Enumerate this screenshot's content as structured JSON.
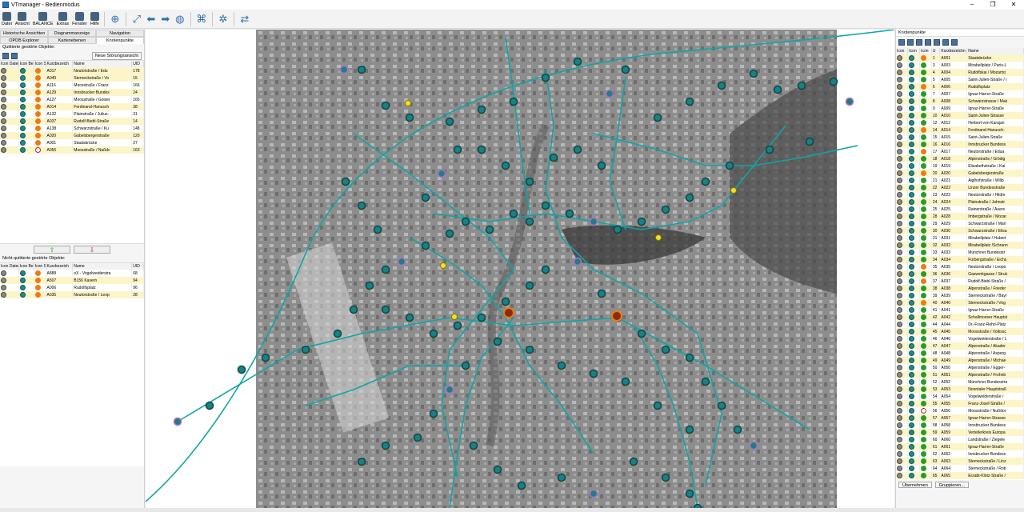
{
  "window": {
    "title": "VTmanager - Bedienmodus"
  },
  "toolbar": {
    "buttons": [
      {
        "label": "Datei",
        "icon": "file-icon"
      },
      {
        "label": "Ansicht",
        "icon": "view-icon"
      },
      {
        "label": "BALANCE",
        "icon": "balance-icon"
      },
      {
        "label": "Extras",
        "icon": "extras-icon"
      },
      {
        "label": "Fenster",
        "icon": "window-icon"
      },
      {
        "label": "Hilfe",
        "icon": "help-icon"
      }
    ]
  },
  "left_panel": {
    "tabs_row1": [
      "Historische Ansichten",
      "Diagrammanzeige",
      "Navigation"
    ],
    "tabs_row2": [
      "OPDB Explorer",
      "Kartenebenen",
      "Knotenpunkte"
    ],
    "top_section_label": "Quittierte gestörte Objekte:",
    "new_fault_button": "Neue Störungsansicht",
    "columns": [
      "Icon Dateria",
      "Icon Be",
      "Icon S",
      "Kurzbezeich",
      "Name",
      "UID"
    ],
    "acknowledged_rows": [
      {
        "status": "orange",
        "code": "A017",
        "name": "Neutorstraße / Edu",
        "uid": "178",
        "hl": true
      },
      {
        "status": "orange",
        "code": "A040",
        "name": "Sterneckstraße / Vo",
        "uid": "15",
        "hl": true
      },
      {
        "status": "orange",
        "code": "A116",
        "name": "Moosstraße / Franz",
        "uid": "166",
        "hl": false
      },
      {
        "status": "orange",
        "code": "A129",
        "name": "Innsbrucker Bundes",
        "uid": "24",
        "hl": true
      },
      {
        "status": "orange",
        "code": "A127",
        "name": "Moosstraße / Goiser",
        "uid": "165",
        "hl": false
      },
      {
        "status": "orange",
        "code": "A014",
        "name": "Ferdinand-Hanusch",
        "uid": "38",
        "hl": true
      },
      {
        "status": "orange",
        "code": "A132",
        "name": "Plainstraße / Julius-",
        "uid": "31",
        "hl": false
      },
      {
        "status": "orange",
        "code": "A037",
        "name": "Rudolf-Biebl-Straße",
        "uid": "14",
        "hl": true
      },
      {
        "status": "orange",
        "code": "A138",
        "name": "Schwarzstraße / Ku",
        "uid": "148",
        "hl": false
      },
      {
        "status": "orange",
        "code": "A020",
        "name": "Gabelsbergerstraße",
        "uid": "120",
        "hl": true
      },
      {
        "status": "orange",
        "code": "A001",
        "name": "Staatsbrücke",
        "uid": "27",
        "hl": false
      },
      {
        "status": "ring",
        "code": "A056",
        "name": "Moosstraße / Nußdc",
        "uid": "163",
        "hl": true
      }
    ],
    "unack_section_label": "Nicht quittierte gestörte Objekte:",
    "unacknowledged_rows": [
      {
        "status": "orange",
        "code": "A888",
        "name": "oX - Vogelweiderstra",
        "uid": "68",
        "hl": false
      },
      {
        "status": "orange",
        "code": "A507",
        "name": "B156 Kasern",
        "uid": "94",
        "hl": true
      },
      {
        "status": "orange",
        "code": "A006",
        "name": "Rudolfsplatz",
        "uid": "96",
        "hl": false
      },
      {
        "status": "orange",
        "code": "A035",
        "name": "Neutorstraße / Leop",
        "uid": "28",
        "hl": true
      }
    ]
  },
  "right_panel": {
    "title": "Knotenpunkte",
    "columns": [
      "Icon",
      "Icon",
      "Icon",
      "U",
      "Kurzbezeichn",
      "Name"
    ],
    "rows": [
      {
        "u": "1",
        "code": "A001",
        "name": "Staatsbrücke",
        "status": "orange"
      },
      {
        "u": "3",
        "code": "A003",
        "name": "Mirabellplatz / Paris-L",
        "status": "green"
      },
      {
        "u": "4",
        "code": "A004",
        "name": "Rudolfskai / Mozartst",
        "status": "green"
      },
      {
        "u": "5",
        "code": "A005",
        "name": "Saint-Julien-Straße / I",
        "status": "green"
      },
      {
        "u": "6",
        "code": "A006",
        "name": "Rudolfsplatz",
        "status": "orange"
      },
      {
        "u": "7",
        "code": "A007",
        "name": "Ignaz-Harrer-Straße",
        "status": "green"
      },
      {
        "u": "8",
        "code": "A008",
        "name": "Schwarzstrasse / Mak",
        "status": "green"
      },
      {
        "u": "9",
        "code": "A009",
        "name": "Ignaz-Harrer-Straße",
        "status": "green"
      },
      {
        "u": "10",
        "code": "A010",
        "name": "Saint-Julien-Strasse",
        "status": "green"
      },
      {
        "u": "12",
        "code": "A012",
        "name": "Herbert-von-Karajan",
        "status": "green"
      },
      {
        "u": "14",
        "code": "A014",
        "name": "Ferdinand-Hanusch-",
        "status": "orange"
      },
      {
        "u": "15",
        "code": "A015",
        "name": "Saint-Julien-Straße",
        "status": "green"
      },
      {
        "u": "16",
        "code": "A016",
        "name": "Innsbrucker Bundess",
        "status": "green"
      },
      {
        "u": "17",
        "code": "A017",
        "name": "Neutorstraße / Edua",
        "status": "orange"
      },
      {
        "u": "18",
        "code": "A018",
        "name": "Alpenstraße / Grödig",
        "status": "green"
      },
      {
        "u": "19",
        "code": "A019",
        "name": "Elisabethstraße / Kai",
        "status": "green"
      },
      {
        "u": "20",
        "code": "A020",
        "name": "Gabelsbergerstraße",
        "status": "orange"
      },
      {
        "u": "21",
        "code": "A021",
        "name": "Aiglhofstraße / Wilib",
        "status": "green"
      },
      {
        "u": "22",
        "code": "A022",
        "name": "Linzer Bundesstraße",
        "status": "green"
      },
      {
        "u": "23",
        "code": "A023",
        "name": "Neutorstraße / Hildm",
        "status": "green"
      },
      {
        "u": "24",
        "code": "A024",
        "name": "Plainstraße / Jahnstr",
        "status": "green"
      },
      {
        "u": "25",
        "code": "A025",
        "name": "Rainerstraße / Auers",
        "status": "green"
      },
      {
        "u": "28",
        "code": "A028",
        "name": "Imbergstraße / Mozar",
        "status": "green"
      },
      {
        "u": "29",
        "code": "A029",
        "name": "Schwarzstraße / Mari",
        "status": "green"
      },
      {
        "u": "30",
        "code": "A030",
        "name": "Schwarzstraße / Elisa",
        "status": "green"
      },
      {
        "u": "31",
        "code": "A031",
        "name": "Mirabellplatz / Hubert",
        "status": "green"
      },
      {
        "u": "32",
        "code": "A032",
        "name": "Mirabellplatz /Schrann",
        "status": "green"
      },
      {
        "u": "33",
        "code": "A033",
        "name": "Münchner Bundesstr",
        "status": "green"
      },
      {
        "u": "34",
        "code": "A034",
        "name": "Fürbergstraße / Eichs",
        "status": "green"
      },
      {
        "u": "35",
        "code": "A035",
        "name": "Neutorstraße / Leopo",
        "status": "orange"
      },
      {
        "u": "36",
        "code": "A036",
        "name": "Gaswerkgasse / Struk",
        "status": "green"
      },
      {
        "u": "37",
        "code": "A037",
        "name": "Rudolf-Biebl-Straße /",
        "status": "orange"
      },
      {
        "u": "38",
        "code": "A038",
        "name": "Alpenstraße / Frieder",
        "status": "green"
      },
      {
        "u": "39",
        "code": "A039",
        "name": "Sterneckstraße / Bayr",
        "status": "green"
      },
      {
        "u": "40",
        "code": "A040",
        "name": "Sterneckstraße / Vog",
        "status": "orange"
      },
      {
        "u": "41",
        "code": "A041",
        "name": "Ignaz-Harrer-Straße",
        "status": "green"
      },
      {
        "u": "42",
        "code": "A042",
        "name": "Schallmooser Hauptst",
        "status": "green"
      },
      {
        "u": "44",
        "code": "A044",
        "name": "Dr.-Franz-Rehrl-Platz",
        "status": "green"
      },
      {
        "u": "45",
        "code": "A045",
        "name": "Moosstraße / Volkssc",
        "status": "green"
      },
      {
        "u": "46",
        "code": "A046",
        "name": "Vogelweiderstraße / L",
        "status": "green"
      },
      {
        "u": "47",
        "code": "A047",
        "name": "Alpenstraße / Akader",
        "status": "green"
      },
      {
        "u": "48",
        "code": "A048",
        "name": "Alpenstraße / Asperg",
        "status": "green"
      },
      {
        "u": "49",
        "code": "A049",
        "name": "Alpenstraße / Michae",
        "status": "green"
      },
      {
        "u": "50",
        "code": "A050",
        "name": "Alpenstraße / Egger-",
        "status": "green"
      },
      {
        "u": "51",
        "code": "A051",
        "name": "Alpenstraße / Frohnb",
        "status": "green"
      },
      {
        "u": "52",
        "code": "A052",
        "name": "Münchner Bundesstra",
        "status": "green"
      },
      {
        "u": "53",
        "code": "A053",
        "name": "Nonntaler Hauptstraß",
        "status": "green"
      },
      {
        "u": "54",
        "code": "A054",
        "name": "Vogelweiderstraße /",
        "status": "green"
      },
      {
        "u": "55",
        "code": "A055",
        "name": "Franz-Josef-Straße /",
        "status": "green"
      },
      {
        "u": "56",
        "code": "A056",
        "name": "Moosstraße / Nußdor",
        "status": "ring"
      },
      {
        "u": "57",
        "code": "A057",
        "name": "Ignaz-Harrer-Strasse",
        "status": "green"
      },
      {
        "u": "58",
        "code": "A058",
        "name": "Innsbrucker Bundess",
        "status": "green"
      },
      {
        "u": "59",
        "code": "A059",
        "name": "Verteilerkreis Europa",
        "status": "green"
      },
      {
        "u": "60",
        "code": "A060",
        "name": "Landstraße / Ziegele",
        "status": "green"
      },
      {
        "u": "61",
        "code": "A061",
        "name": "Ignaz-Harrer-Straße",
        "status": "green"
      },
      {
        "u": "62",
        "code": "A062",
        "name": "Innsbrucker Bundess",
        "status": "green"
      },
      {
        "u": "63",
        "code": "A063",
        "name": "Sterneckstraße / Linz",
        "status": "green"
      },
      {
        "u": "64",
        "code": "A064",
        "name": "Sterneckstraße / Rob",
        "status": "green"
      },
      {
        "u": "65",
        "code": "A065",
        "name": "Erzabt-Klotz-Straße /",
        "status": "green"
      }
    ],
    "apply_button": "Übernehmen",
    "group_button": "Gruppieren..."
  }
}
